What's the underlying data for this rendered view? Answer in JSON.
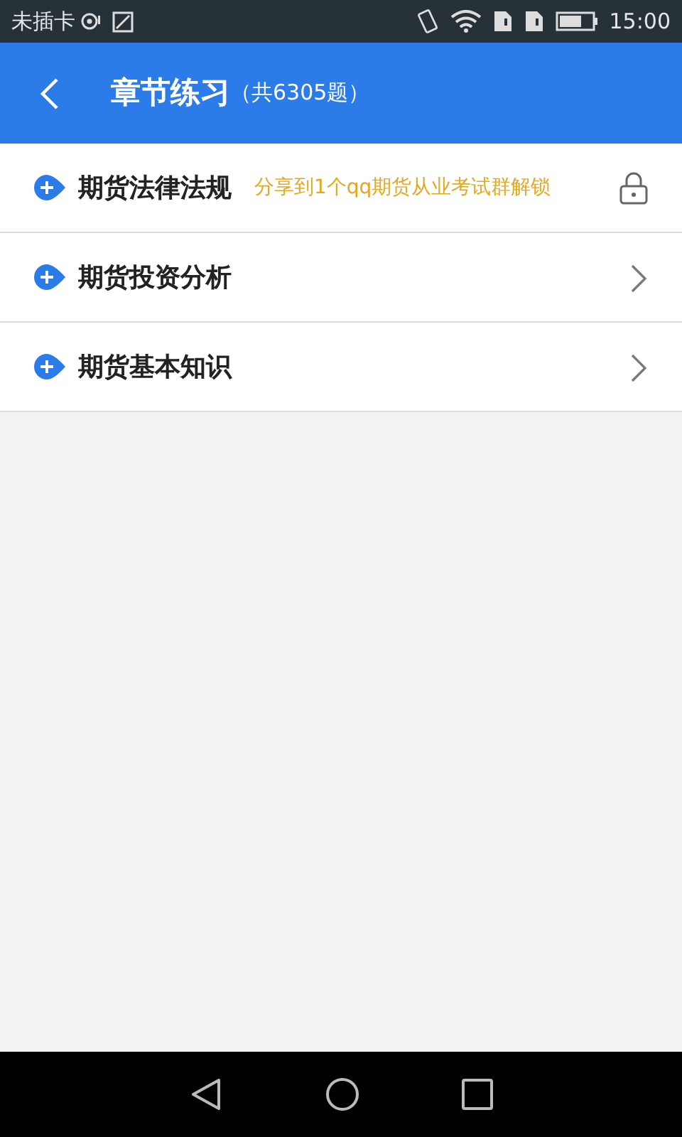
{
  "status_bar": {
    "carrier": "未插卡",
    "time": "15:00"
  },
  "header": {
    "title": "章节练习",
    "count": "（共6305题）"
  },
  "chapters": [
    {
      "title": "期货法律法规",
      "kind": "locked",
      "unlock_hint": "分享到1个qq期货从业考试群解锁"
    },
    {
      "title": "期货投资分析",
      "kind": "open"
    },
    {
      "title": "期货基本知识",
      "kind": "open"
    }
  ]
}
